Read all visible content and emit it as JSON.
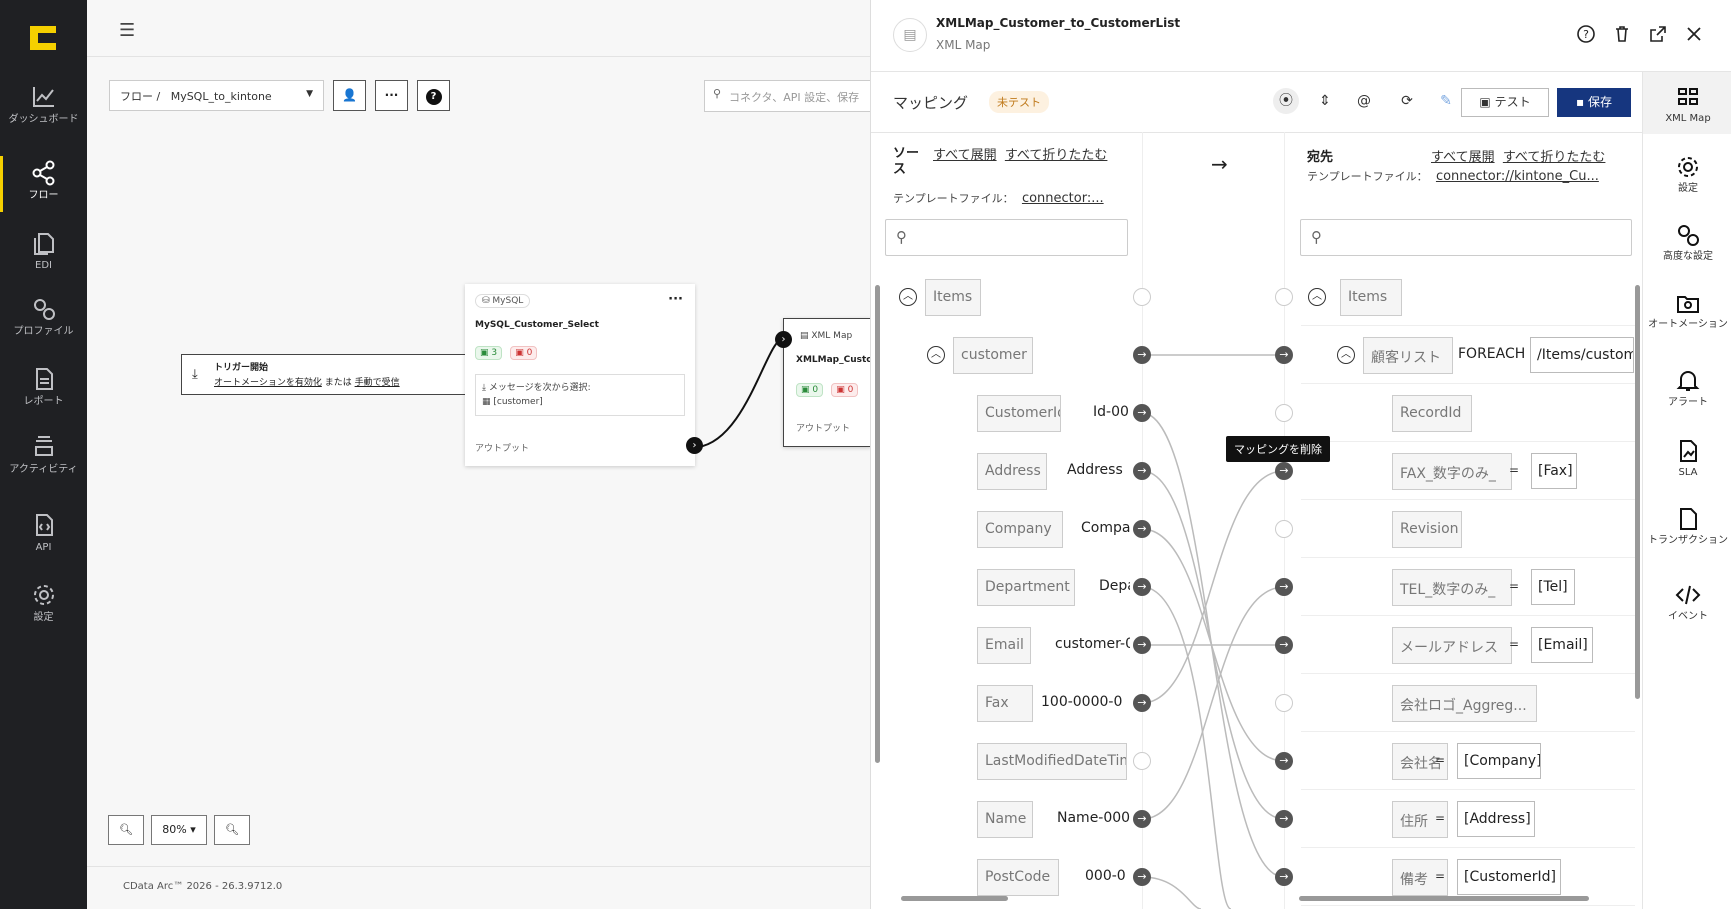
{
  "sidebar": {
    "items": [
      {
        "label": "ダッシュボード",
        "icon": "chart-line-icon"
      },
      {
        "label": "フロー",
        "icon": "share-nodes-icon"
      },
      {
        "label": "EDI",
        "icon": "documents-icon"
      },
      {
        "label": "プロファイル",
        "icon": "gears-icon"
      },
      {
        "label": "レポート",
        "icon": "report-icon"
      },
      {
        "label": "アクティビティ",
        "icon": "layers-icon"
      },
      {
        "label": "API",
        "icon": "api-file-icon"
      },
      {
        "label": "設定",
        "icon": "gear-icon"
      }
    ]
  },
  "canvas": {
    "breadcrumb_root": "フロー",
    "flow_name": "MySQL_to_kintone",
    "search_placeholder": "コネクタ、API 設定、保存",
    "trigger": {
      "title": "トリガー開始",
      "link1": "オートメーションを有効化",
      "middle": "または",
      "link2": "手動で受信"
    },
    "mysql_node": {
      "type": "MySQL",
      "name": "MySQL_Customer_Select",
      "count_ok": "3",
      "count_err": "0",
      "msg_label": "メッセージを次から選択:",
      "msg_value": "[customer]",
      "output": "アウトプット"
    },
    "xmlmap_node": {
      "type": "XML Map",
      "name": "XMLMap_Customer_to_CustomerList",
      "count_ok": "0",
      "count_err": "0",
      "output": "アウトプット"
    },
    "zoom_level": "80%",
    "footer": "CData Arc™ 2026 - 26.3.9712.0"
  },
  "panel": {
    "title": "XMLMap_Customer_to_CustomerList",
    "subtitle": "XML Map",
    "toolbar": {
      "label": "マッピング",
      "status": "未テスト",
      "test": "テスト",
      "save": "保存"
    },
    "source": {
      "heading": "ソース",
      "expand": "すべて展開",
      "collapse": "すべて折りたたむ",
      "template_label": "テンプレートファイル：",
      "template_value": "connector:..."
    },
    "dest": {
      "heading": "宛先",
      "expand": "すべて展開",
      "collapse": "すべて折りたたむ",
      "template_label": "テンプレートファイル：",
      "template_value": "connector://kintone_Cu..."
    },
    "arrow": "→",
    "tooltip": "マッピングを削除",
    "source_tree": [
      {
        "name": "Items",
        "value": ""
      },
      {
        "name": "customer",
        "value": ""
      },
      {
        "name": "CustomerId",
        "value": "Id-00"
      },
      {
        "name": "Address",
        "value": "Address"
      },
      {
        "name": "Company",
        "value": "Compa"
      },
      {
        "name": "Department",
        "value": "Depa"
      },
      {
        "name": "Email",
        "value": "customer-0"
      },
      {
        "name": "Fax",
        "value": "100-0000-0"
      },
      {
        "name": "LastModifiedDateTime",
        "value": ""
      },
      {
        "name": "Name",
        "value": "Name-000"
      },
      {
        "name": "PostCode",
        "value": "000-0"
      }
    ],
    "dest_tree": [
      {
        "name": "Items",
        "value": ""
      },
      {
        "name": "顧客リスト",
        "foreach": "FOREACH",
        "value": "/Items/customer"
      },
      {
        "name": "RecordId",
        "value": ""
      },
      {
        "name": "FAX_数字のみ_",
        "value": "[Fax]"
      },
      {
        "name": "Revision",
        "value": ""
      },
      {
        "name": "TEL_数字のみ_",
        "value": "[Tel]"
      },
      {
        "name": "メールアドレス",
        "value": "[Email]"
      },
      {
        "name": "会社ロゴ_Aggreg...",
        "value": ""
      },
      {
        "name": "会社名",
        "value": "[Company]"
      },
      {
        "name": "住所",
        "value": "[Address]"
      },
      {
        "name": "備考",
        "value": "[CustomerId]"
      }
    ],
    "right_nav": [
      {
        "label": "XML Map",
        "icon": "xml-map-icon"
      },
      {
        "label": "設定",
        "icon": "gear-icon"
      },
      {
        "label": "高度な設定",
        "icon": "advanced-gears-icon"
      },
      {
        "label": "オートメーション",
        "icon": "automation-folder-icon"
      },
      {
        "label": "アラート",
        "icon": "bell-icon"
      },
      {
        "label": "SLA",
        "icon": "sla-file-icon"
      },
      {
        "label": "トランザクション",
        "icon": "transaction-file-icon"
      },
      {
        "label": "イベント",
        "icon": "code-icon"
      }
    ],
    "equals": "="
  },
  "colors": {
    "sidebar_bg": "#1f2023",
    "accent": "#f5d000",
    "save_bg": "#16367f"
  }
}
